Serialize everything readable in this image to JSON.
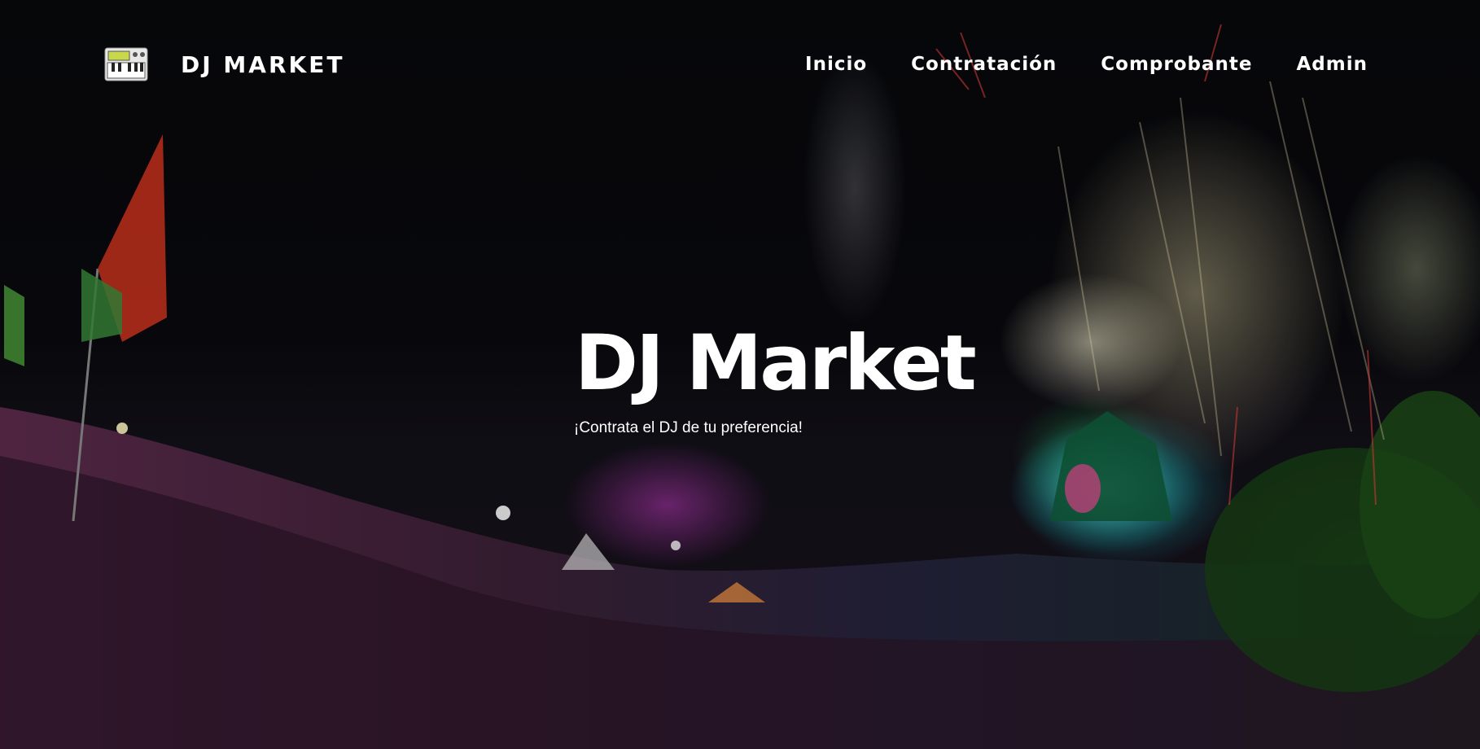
{
  "navbar": {
    "brand_icon": "piano-keyboard-icon",
    "brand_text": "DJ MARKET",
    "links": [
      {
        "label": "Inicio"
      },
      {
        "label": "Contratación"
      },
      {
        "label": "Comprobante"
      },
      {
        "label": "Admin"
      }
    ]
  },
  "hero": {
    "title": "DJ Market",
    "subtitle": "¡Contrata el DJ de tu preferencia!",
    "background_image": "festival-crowd-fireworks-stage-photo"
  },
  "colors": {
    "text": "#ffffff",
    "background": "#07080b"
  }
}
